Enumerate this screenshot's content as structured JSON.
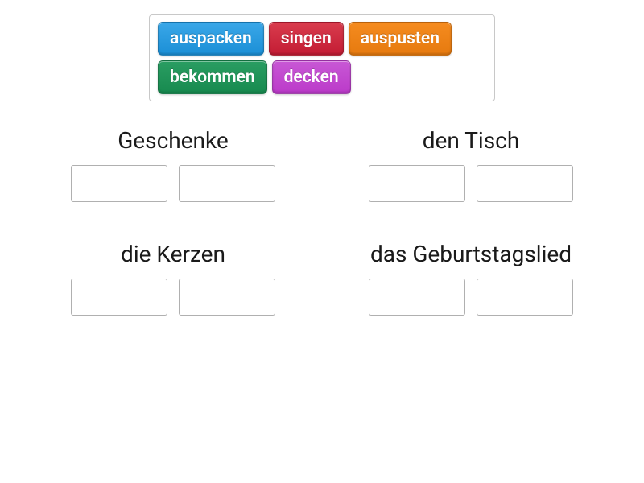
{
  "word_bank": {
    "tiles": [
      {
        "label": "auspacken",
        "color": "blue"
      },
      {
        "label": "singen",
        "color": "red"
      },
      {
        "label": "auspusten",
        "color": "orange"
      },
      {
        "label": "bekommen",
        "color": "green"
      },
      {
        "label": "decken",
        "color": "magenta"
      }
    ]
  },
  "categories": [
    {
      "label": "Geschenke",
      "slots": 2
    },
    {
      "label": "den Tisch",
      "slots": 2
    },
    {
      "label": "die Kerzen",
      "slots": 2
    },
    {
      "label": "das Geburtstagslied",
      "slots": 2
    }
  ]
}
